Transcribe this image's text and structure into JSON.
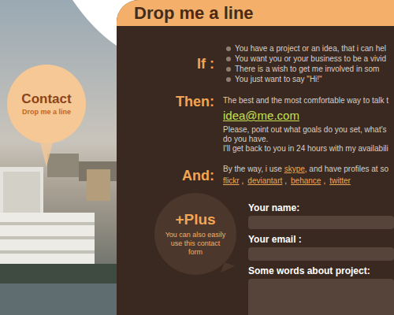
{
  "header": {
    "title": "Drop me a line"
  },
  "badge": {
    "title": "Contact",
    "subtitle": "Drop me a line"
  },
  "if": {
    "label": "If :",
    "items": [
      "You have a project or an idea, that i can hel",
      "You want you or your business to be a vivid",
      "There is a wish to get me involved in som",
      "You just want to say \"Hi!\""
    ]
  },
  "then": {
    "label": "Then:",
    "intro": "The best and the most comfortable way to talk t",
    "email": "idea@me.com",
    "lines": [
      "Please, point out what goals do you set, what's",
      "do you have.",
      "I'll get back to you in 24 hours with my availabili"
    ]
  },
  "and": {
    "label": "And:",
    "text_before": "By the way, i use ",
    "skype": "skype",
    "text_after": ", and have profiles at so",
    "profiles": [
      "flickr",
      "deviantart",
      "behance",
      "twitter"
    ],
    "separator": ","
  },
  "plus": {
    "title": "+Plus",
    "text": "You can also easily use this contact form"
  },
  "form": {
    "fields": [
      {
        "label": "Your name:",
        "kind": "input"
      },
      {
        "label": "Your email :",
        "kind": "input"
      },
      {
        "label": "Some words about project:",
        "kind": "textarea"
      }
    ]
  }
}
